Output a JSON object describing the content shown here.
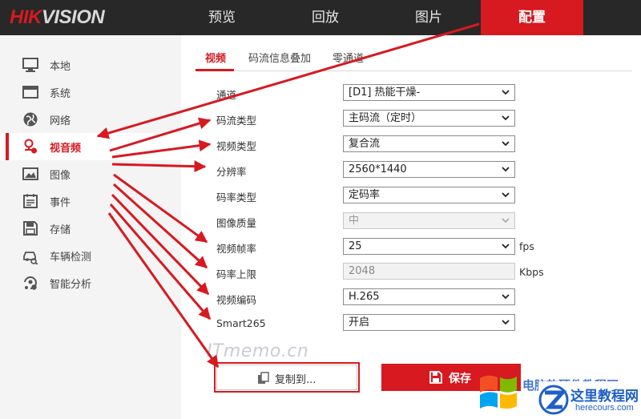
{
  "brand": {
    "logo_red": "HIK",
    "logo_gray": "VISION"
  },
  "nav": [
    {
      "label": "预览",
      "active": false
    },
    {
      "label": "回放",
      "active": false
    },
    {
      "label": "图片",
      "active": false
    },
    {
      "label": "配置",
      "active": true
    }
  ],
  "sidebar": [
    {
      "label": "本地",
      "icon": "monitor-icon"
    },
    {
      "label": "系统",
      "icon": "system-window-icon"
    },
    {
      "label": "网络",
      "icon": "globe-icon"
    },
    {
      "label": "视音频",
      "icon": "audio-video-icon",
      "active": true
    },
    {
      "label": "图像",
      "icon": "image-icon"
    },
    {
      "label": "事件",
      "icon": "calendar-icon"
    },
    {
      "label": "存储",
      "icon": "floppy-disk-icon"
    },
    {
      "label": "车辆检测",
      "icon": "vehicle-camera-icon"
    },
    {
      "label": "智能分析",
      "icon": "smart-analysis-icon"
    }
  ],
  "tabs": [
    {
      "label": "视频",
      "active": true
    },
    {
      "label": "码流信息叠加",
      "active": false
    },
    {
      "label": "零通道",
      "active": false
    }
  ],
  "form": {
    "channel": {
      "label": "通道",
      "value": "[D1] 热能干燥-"
    },
    "stream_type": {
      "label": "码流类型",
      "value": "主码流（定时）"
    },
    "video_type": {
      "label": "视频类型",
      "value": "复合流"
    },
    "resolution": {
      "label": "分辨率",
      "value": "2560*1440"
    },
    "bitrate_type": {
      "label": "码率类型",
      "value": "定码率"
    },
    "image_quality": {
      "label": "图像质量",
      "value": "中",
      "disabled": true
    },
    "frame_rate": {
      "label": "视频帧率",
      "value": "25",
      "unit": "fps"
    },
    "bitrate_limit": {
      "label": "码率上限",
      "value": "2048",
      "unit": "Kbps"
    },
    "video_encoding": {
      "label": "视频编码",
      "value": "H.265"
    },
    "smart265": {
      "label": "Smart265",
      "value": "开启"
    }
  },
  "buttons": {
    "copy": "复制到...",
    "save": "保存"
  },
  "watermark": "ITmemo.cn",
  "branding": {
    "faded_text": "电脑软硬件教程网",
    "main": "这里教程网",
    "sub": "herecours.com"
  },
  "colors": {
    "accent": "#d71920",
    "topbar": "#282828",
    "sidebar_bg": "#f4f4f4",
    "brand_blue": "#1f5fc7"
  }
}
